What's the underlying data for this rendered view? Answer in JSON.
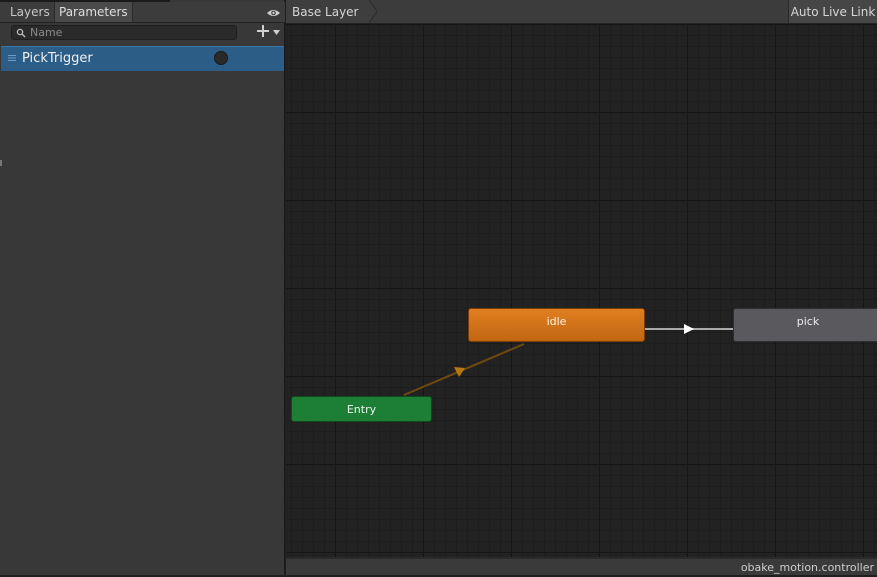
{
  "left_panel": {
    "tabs": [
      {
        "label": "Layers"
      },
      {
        "label": "Parameters"
      }
    ],
    "search": {
      "placeholder": "Name",
      "value": ""
    },
    "parameters": [
      {
        "name": "PickTrigger",
        "type": "trigger",
        "value": false
      }
    ]
  },
  "graph": {
    "breadcrumb": "Base Layer",
    "auto_live_link_label": "Auto Live Link",
    "states": {
      "idle": {
        "label": "idle",
        "color": "#d9761c",
        "default": true
      },
      "pick": {
        "label": "pick",
        "color": "#5a5a5e"
      },
      "entry": {
        "label": "Entry",
        "color": "#1d7f36"
      }
    },
    "transitions": [
      {
        "from": "Entry",
        "to": "idle",
        "color": "#8a5a12"
      },
      {
        "from": "idle",
        "to": "pick",
        "color": "#bdbdbd"
      }
    ]
  },
  "status_bar": {
    "file": "obake_motion.controller"
  },
  "icons": [
    "eye-icon",
    "search-icon",
    "plus-icon",
    "chevron-down-icon",
    "drag-handle-icon"
  ]
}
